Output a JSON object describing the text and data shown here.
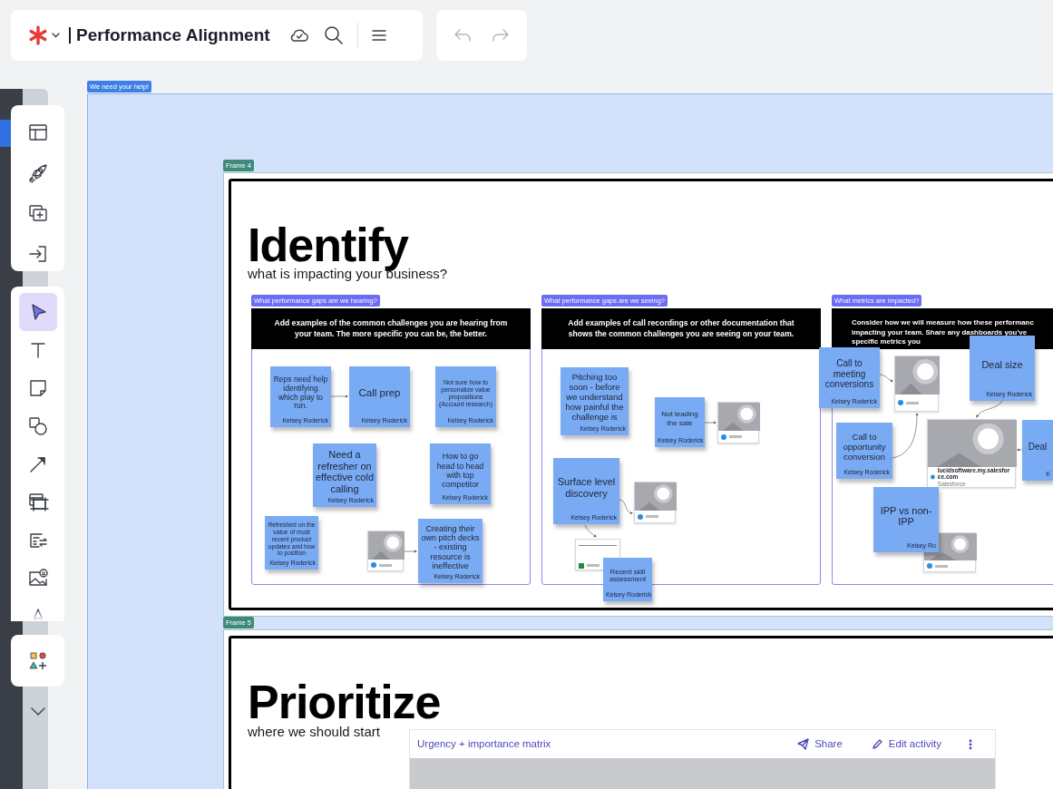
{
  "toolbar": {
    "title": "Performance Alignment"
  },
  "tools": [
    {
      "kind": "select",
      "selected": true
    },
    {
      "kind": "text",
      "selected": false
    },
    {
      "kind": "sticky",
      "selected": false
    },
    {
      "kind": "shapes",
      "selected": false
    },
    {
      "kind": "line",
      "selected": false
    },
    {
      "kind": "frame",
      "selected": false
    },
    {
      "kind": "card",
      "selected": false
    },
    {
      "kind": "image",
      "selected": false
    },
    {
      "kind": "pen",
      "selected": false
    }
  ],
  "canvas": {
    "outer_frame_label": "We need your help!",
    "frames": [
      {
        "label": "Frame 4",
        "title": "Identify",
        "subtitle": "what is impacting your business?",
        "sections": [
          {
            "tag": "What performance gaps are we hearing?",
            "header_lines": [
              "Add examples of the common challenges you are hearing from",
              "your team. The more specific you can be, the better."
            ],
            "stickies": [
              {
                "text": "Reps need help identifying which play to run.",
                "author": "Kelsey Roderick"
              },
              {
                "text": "Call prep",
                "author": "Kelsey Roderick"
              },
              {
                "text": "Not sure how to personalize value propositions (Account research)",
                "author": "Kelsey Roderick"
              },
              {
                "text": "Need a refresher on effective cold calling",
                "author": "Kelsey Roderick"
              },
              {
                "text": "How to go head to head with top competitor",
                "author": "Kelsey Roderick"
              },
              {
                "text": "Refreshed on the value of most recent product updates and how to position",
                "author": "Kelsey Roderick"
              },
              {
                "text": "Creating their own pitch decks - existing resource is ineffective",
                "author": "Kelsey Roderick"
              }
            ],
            "link_cards": [
              {
                "kind": "image"
              }
            ]
          },
          {
            "tag": "What performance gaps are we seeing?",
            "header_lines": [
              "Add examples of call recordings or other documentation that",
              "shows the common challenges you are seeing on your team."
            ],
            "stickies": [
              {
                "text": "Pitching too soon - before we understand how painful the challenge is",
                "author": "Kelsey Roderick"
              },
              {
                "text": "Not leading the sale",
                "author": "Kelsey Roderick"
              },
              {
                "text": "Surface level discovery",
                "author": "Kelsey Roderick"
              },
              {
                "text": "Recent skill assessment",
                "author": "Kelsey Roderick"
              }
            ],
            "link_cards": [
              {
                "kind": "image"
              },
              {
                "kind": "image"
              },
              {
                "kind": "doc"
              }
            ]
          },
          {
            "tag": "What metrics are impacted?",
            "header_lines": [
              "Consider how we will measure how these performanc",
              "impacting your team. Share any dashboards you've",
              "specific metrics you"
            ],
            "stickies": [
              {
                "text": "Call to meeting conversions",
                "author": "Kelsey Roderick"
              },
              {
                "text": "Deal size",
                "author": "Kelsey Roderick"
              },
              {
                "text": "Call to opportunity conversion",
                "author": "Kelsey Roderick"
              },
              {
                "text": "Deal",
                "author": "K"
              },
              {
                "text": "IPP vs non-IPP",
                "author": "Kelsey Ro"
              }
            ],
            "link_cards": [
              {
                "kind": "image"
              },
              {
                "kind": "image",
                "title": "lucidsoftware.my.salesforce.com",
                "source": "Salesforce"
              },
              {
                "kind": "image"
              }
            ]
          }
        ]
      },
      {
        "label": "Frame 5",
        "title": "Prioritize",
        "subtitle": "where we should start",
        "activity": {
          "title": "Urgency + importance matrix",
          "buttons": [
            "Share",
            "Edit activity"
          ]
        }
      }
    ]
  }
}
